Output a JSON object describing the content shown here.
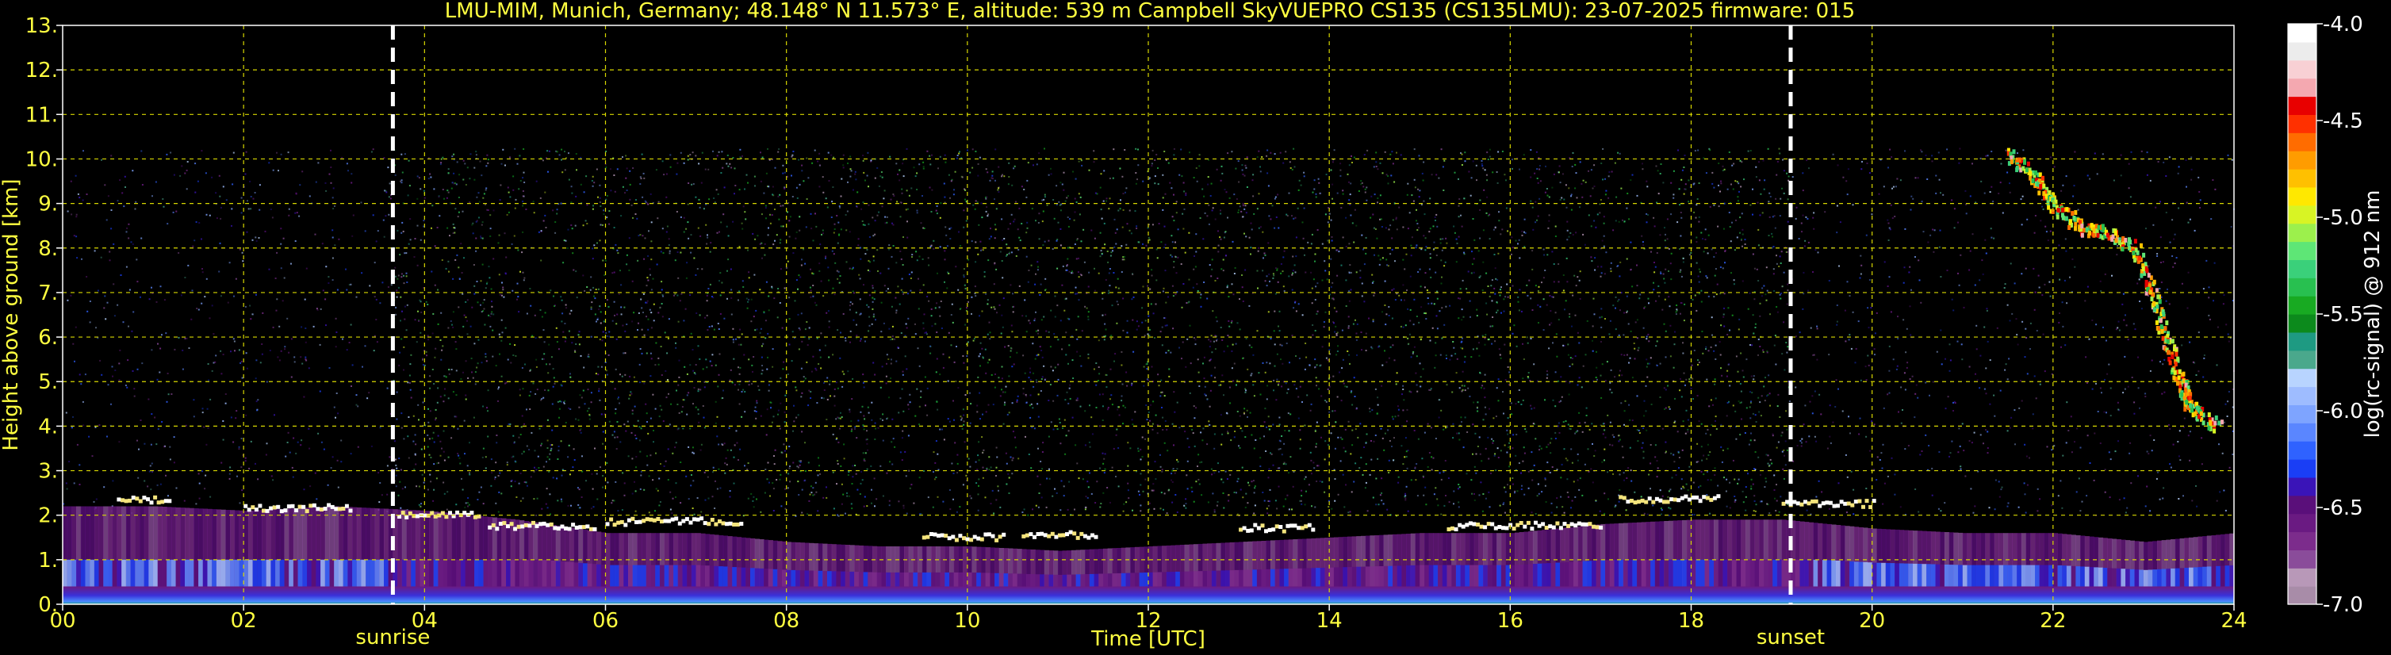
{
  "chart_data": {
    "type": "heatmap",
    "title": "LMU-MIM, Munich, Germany; 48.148° N 11.573° E, altitude: 539 m    Campbell SkyVUEPRO CS135 (CS135LMU): 23-07-2025    firmware: 015",
    "xlabel": "Time [UTC]",
    "ylabel": "Height above ground [km]",
    "colorbar_label": "log(rc-signal) @ 912 nm",
    "xlim": [
      0,
      24
    ],
    "ylim": [
      0,
      13
    ],
    "x_ticks": [
      {
        "value": 0,
        "label": "00"
      },
      {
        "value": 2,
        "label": "02"
      },
      {
        "value": 4,
        "label": "04"
      },
      {
        "value": 6,
        "label": "06"
      },
      {
        "value": 8,
        "label": "08"
      },
      {
        "value": 10,
        "label": "10"
      },
      {
        "value": 12,
        "label": "12"
      },
      {
        "value": 14,
        "label": "14"
      },
      {
        "value": 16,
        "label": "16"
      },
      {
        "value": 18,
        "label": "18"
      },
      {
        "value": 20,
        "label": "20"
      },
      {
        "value": 22,
        "label": "22"
      },
      {
        "value": 24,
        "label": "24"
      }
    ],
    "y_ticks": [
      {
        "value": 0,
        "label": "0."
      },
      {
        "value": 1,
        "label": "1."
      },
      {
        "value": 2,
        "label": "2."
      },
      {
        "value": 3,
        "label": "3."
      },
      {
        "value": 4,
        "label": "4."
      },
      {
        "value": 5,
        "label": "5."
      },
      {
        "value": 6,
        "label": "6."
      },
      {
        "value": 7,
        "label": "7."
      },
      {
        "value": 8,
        "label": "8."
      },
      {
        "value": 9,
        "label": "9."
      },
      {
        "value": 10,
        "label": "10."
      },
      {
        "value": 11,
        "label": "11."
      },
      {
        "value": 12,
        "label": "12."
      },
      {
        "value": 13,
        "label": "13."
      }
    ],
    "grid": true,
    "grid_color": "#d8d800",
    "colorbar": {
      "range": [
        -7.0,
        -4.0
      ],
      "ticks": [
        {
          "value": -4.0,
          "label": "-4.0"
        },
        {
          "value": -4.5,
          "label": "-4.5"
        },
        {
          "value": -5.0,
          "label": "-5.0"
        },
        {
          "value": -5.5,
          "label": "-5.5"
        },
        {
          "value": -6.0,
          "label": "-6.0"
        },
        {
          "value": -6.5,
          "label": "-6.5"
        },
        {
          "value": -7.0,
          "label": "-7.0"
        }
      ],
      "colors": [
        "#a88ca8",
        "#b898b8",
        "#8a4c9a",
        "#7c2c8c",
        "#6a1a82",
        "#5a0f7a",
        "#3a14b8",
        "#1a3ef5",
        "#2f62ff",
        "#5a86ff",
        "#7ea4ff",
        "#9ebcff",
        "#b8d4ff",
        "#4aa88c",
        "#1e9a82",
        "#0c8a1c",
        "#18aa22",
        "#28c050",
        "#3ad07a",
        "#5ee676",
        "#9cf04c",
        "#d8f424",
        "#ffe800",
        "#ffc000",
        "#ff9c00",
        "#ff6c00",
        "#ff3000",
        "#e80000",
        "#f4a8b0",
        "#f8d0d4",
        "#ececec",
        "#ffffff"
      ]
    },
    "events": [
      {
        "name": "sunrise",
        "time": 3.65
      },
      {
        "name": "sunset",
        "time": 19.1
      }
    ],
    "signal_top_km": 10.25,
    "features": {
      "boundary_layer_top_km": [
        [
          0,
          2.2
        ],
        [
          1,
          2.2
        ],
        [
          2,
          2.1
        ],
        [
          3,
          2.2
        ],
        [
          4,
          2.1
        ],
        [
          5,
          1.9
        ],
        [
          6,
          1.6
        ],
        [
          7,
          1.6
        ],
        [
          8,
          1.4
        ],
        [
          9,
          1.3
        ],
        [
          10,
          1.3
        ],
        [
          11,
          1.2
        ],
        [
          12,
          1.3
        ],
        [
          13,
          1.4
        ],
        [
          14,
          1.5
        ],
        [
          15,
          1.6
        ],
        [
          16,
          1.6
        ],
        [
          17,
          1.8
        ],
        [
          18,
          1.9
        ],
        [
          19,
          1.9
        ],
        [
          20,
          1.7
        ],
        [
          21,
          1.6
        ],
        [
          22,
          1.6
        ],
        [
          23,
          1.4
        ],
        [
          24,
          1.6
        ]
      ],
      "cloud_layers": [
        {
          "t0": 0.6,
          "t1": 1.2,
          "h": 2.4
        },
        {
          "t0": 2.0,
          "t1": 3.2,
          "h": 2.2
        },
        {
          "t0": 3.7,
          "t1": 4.6,
          "h": 2.05
        },
        {
          "t0": 4.7,
          "t1": 5.9,
          "h": 1.8
        },
        {
          "t0": 6.0,
          "t1": 7.5,
          "h": 1.9
        },
        {
          "t0": 9.5,
          "t1": 10.4,
          "h": 1.55
        },
        {
          "t0": 10.6,
          "t1": 11.4,
          "h": 1.6
        },
        {
          "t0": 13.0,
          "t1": 13.8,
          "h": 1.75
        },
        {
          "t0": 15.3,
          "t1": 17.0,
          "h": 1.8
        },
        {
          "t0": 17.2,
          "t1": 18.3,
          "h": 2.4
        },
        {
          "t0": 19.0,
          "t1": 20.0,
          "h": 2.3
        }
      ],
      "cirrus_track": [
        [
          21.5,
          10.2
        ],
        [
          21.8,
          9.6
        ],
        [
          22.0,
          9.0
        ],
        [
          22.3,
          8.5
        ],
        [
          22.6,
          8.4
        ],
        [
          22.9,
          8.0
        ],
        [
          23.1,
          7.0
        ],
        [
          23.25,
          6.0
        ],
        [
          23.4,
          5.0
        ],
        [
          23.5,
          4.5
        ],
        [
          23.8,
          4.0
        ]
      ]
    }
  }
}
